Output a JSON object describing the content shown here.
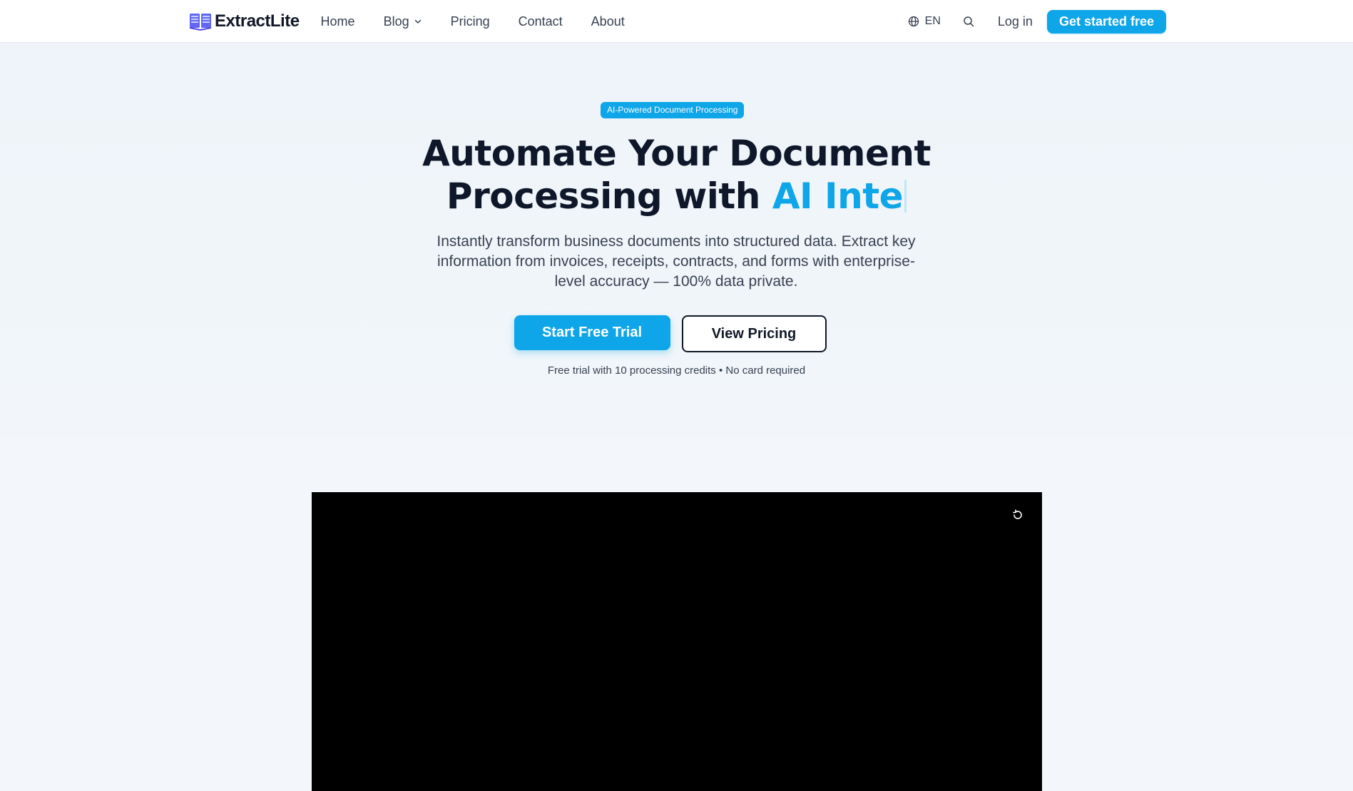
{
  "brand": {
    "name": "ExtractLite",
    "accent_color": "#0ea5e9",
    "logo_color": "#5b5bd6"
  },
  "nav": {
    "links": [
      {
        "label": "Home"
      },
      {
        "label": "Blog",
        "has_dropdown": true
      },
      {
        "label": "Pricing"
      },
      {
        "label": "Contact"
      },
      {
        "label": "About"
      }
    ],
    "language": "EN",
    "login_label": "Log in",
    "cta_label": "Get started free",
    "icons": [
      "globe-icon",
      "search-icon",
      "chevron-down-icon"
    ]
  },
  "hero": {
    "badge": "AI-Powered Document Processing",
    "headline_line1": "Automate Your Document",
    "headline_line2_prefix": "Processing with",
    "headline_typed": "AI Inte",
    "subhead": "Instantly transform business documents into structured data. Extract key information from invoices, receipts, contracts, and forms with enterprise-level accuracy — 100% data private.",
    "primary_button": "Start Free Trial",
    "secondary_button": "View Pricing",
    "trial_note": "Free trial with 10 processing credits • No card required"
  },
  "video": {
    "background": "#000000",
    "controls": [
      "replay-icon"
    ]
  }
}
